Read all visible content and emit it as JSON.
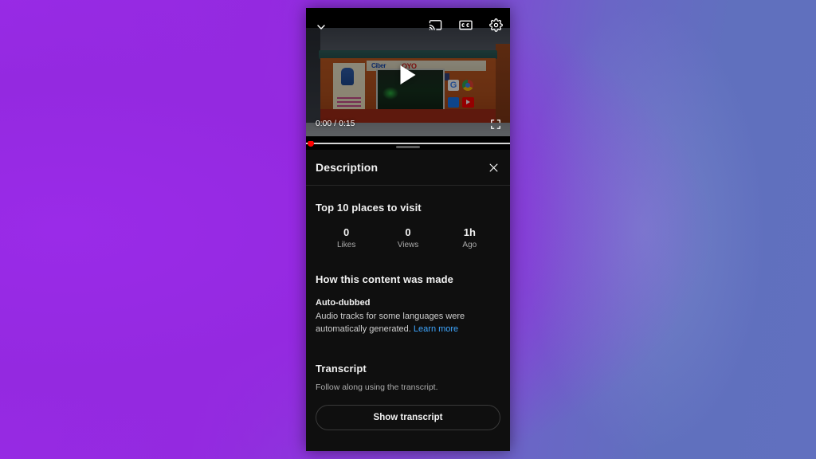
{
  "background": {
    "left_color": "#9429e0",
    "right_color": "#6070be"
  },
  "player": {
    "collapse_icon": "chevron-down-icon",
    "cast_icon": "cast-icon",
    "captions_icon": "closed-captions-icon",
    "settings_icon": "gear-icon",
    "play_icon": "play-icon",
    "fullscreen_icon": "fullscreen-icon",
    "time_display": "0:00 / 0:15",
    "current_time": "0:00",
    "duration": "0:15",
    "progress_percent": 0,
    "scrubber_color": "#ff0000"
  },
  "sheet": {
    "title": "Description",
    "close_icon": "close-icon",
    "drag_handle": "drag-handle",
    "video_title": "Top 10 places to visit",
    "stats": [
      {
        "value": "0",
        "label": "Likes"
      },
      {
        "value": "0",
        "label": "Views"
      },
      {
        "value": "1h",
        "label": "Ago"
      }
    ],
    "how_made": {
      "heading": "How this content was made",
      "item_title": "Auto-dubbed",
      "item_body": "Audio tracks for some languages were automatically generated.",
      "learn_more": "Learn more",
      "link_color": "#3ea6ff"
    },
    "transcript": {
      "heading": "Transcript",
      "caption": "Follow along using the transcript.",
      "button_label": "Show transcript"
    }
  }
}
